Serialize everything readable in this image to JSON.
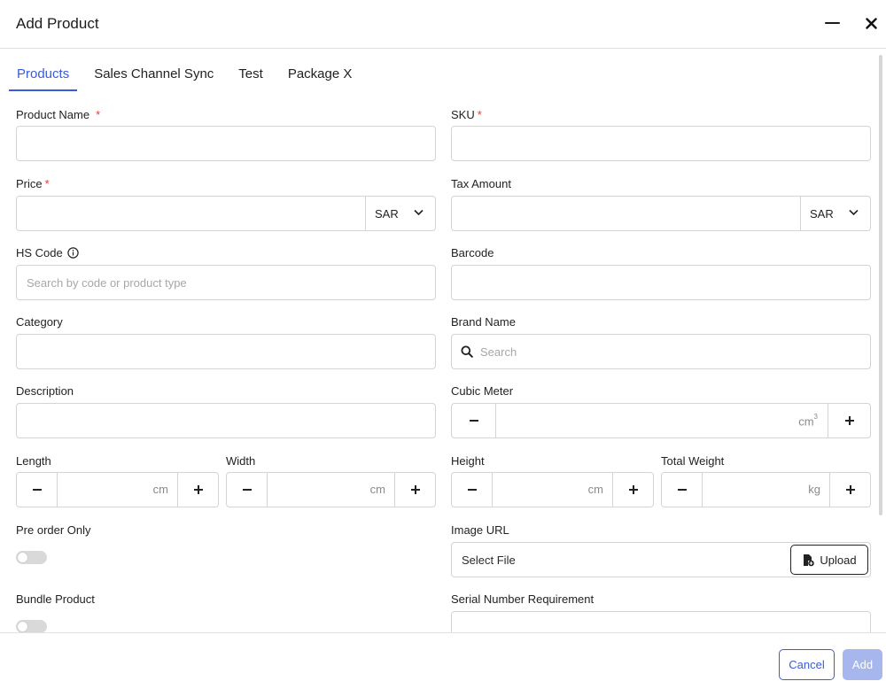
{
  "dialog": {
    "title": "Add Product"
  },
  "tabs": [
    {
      "label": "Products",
      "active": true
    },
    {
      "label": "Sales Channel Sync",
      "active": false
    },
    {
      "label": "Test",
      "active": false
    },
    {
      "label": "Package X",
      "active": false
    }
  ],
  "fields": {
    "product_name": {
      "label": "Product Name",
      "required": "*",
      "value": ""
    },
    "sku": {
      "label": "SKU",
      "required": "*",
      "value": ""
    },
    "price": {
      "label": "Price",
      "required": "*",
      "value": "",
      "currency": "SAR"
    },
    "tax_amount": {
      "label": "Tax Amount",
      "value": "",
      "currency": "SAR"
    },
    "hs_code": {
      "label": "HS Code",
      "placeholder": "Search by code or product type"
    },
    "barcode": {
      "label": "Barcode",
      "value": ""
    },
    "category": {
      "label": "Category",
      "value": ""
    },
    "brand_name": {
      "label": "Brand Name",
      "placeholder": "Search"
    },
    "description": {
      "label": "Description",
      "value": ""
    },
    "cubic_meter": {
      "label": "Cubic Meter",
      "unit": "cm",
      "unit_sup": "3"
    },
    "length": {
      "label": "Length",
      "unit": "cm"
    },
    "width": {
      "label": "Width",
      "unit": "cm"
    },
    "height": {
      "label": "Height",
      "unit": "cm"
    },
    "total_weight": {
      "label": "Total Weight",
      "unit": "kg"
    },
    "pre_order": {
      "label": "Pre order Only",
      "enabled": false
    },
    "image_url": {
      "label": "Image URL",
      "value": "Select File",
      "upload_label": "Upload"
    },
    "bundle_product": {
      "label": "Bundle Product",
      "enabled": false
    },
    "serial_number": {
      "label": "Serial Number Requirement"
    }
  },
  "footer": {
    "cancel_label": "Cancel",
    "add_label": "Add"
  },
  "colors": {
    "accent": "#3a5cd8",
    "required": "#e03a3a",
    "add_disabled": "#a7b7ee"
  },
  "icons": [
    "minimize-icon",
    "close-icon",
    "info-icon",
    "chevron-down-icon",
    "search-icon",
    "minus-icon",
    "plus-icon",
    "file-upload-icon"
  ]
}
